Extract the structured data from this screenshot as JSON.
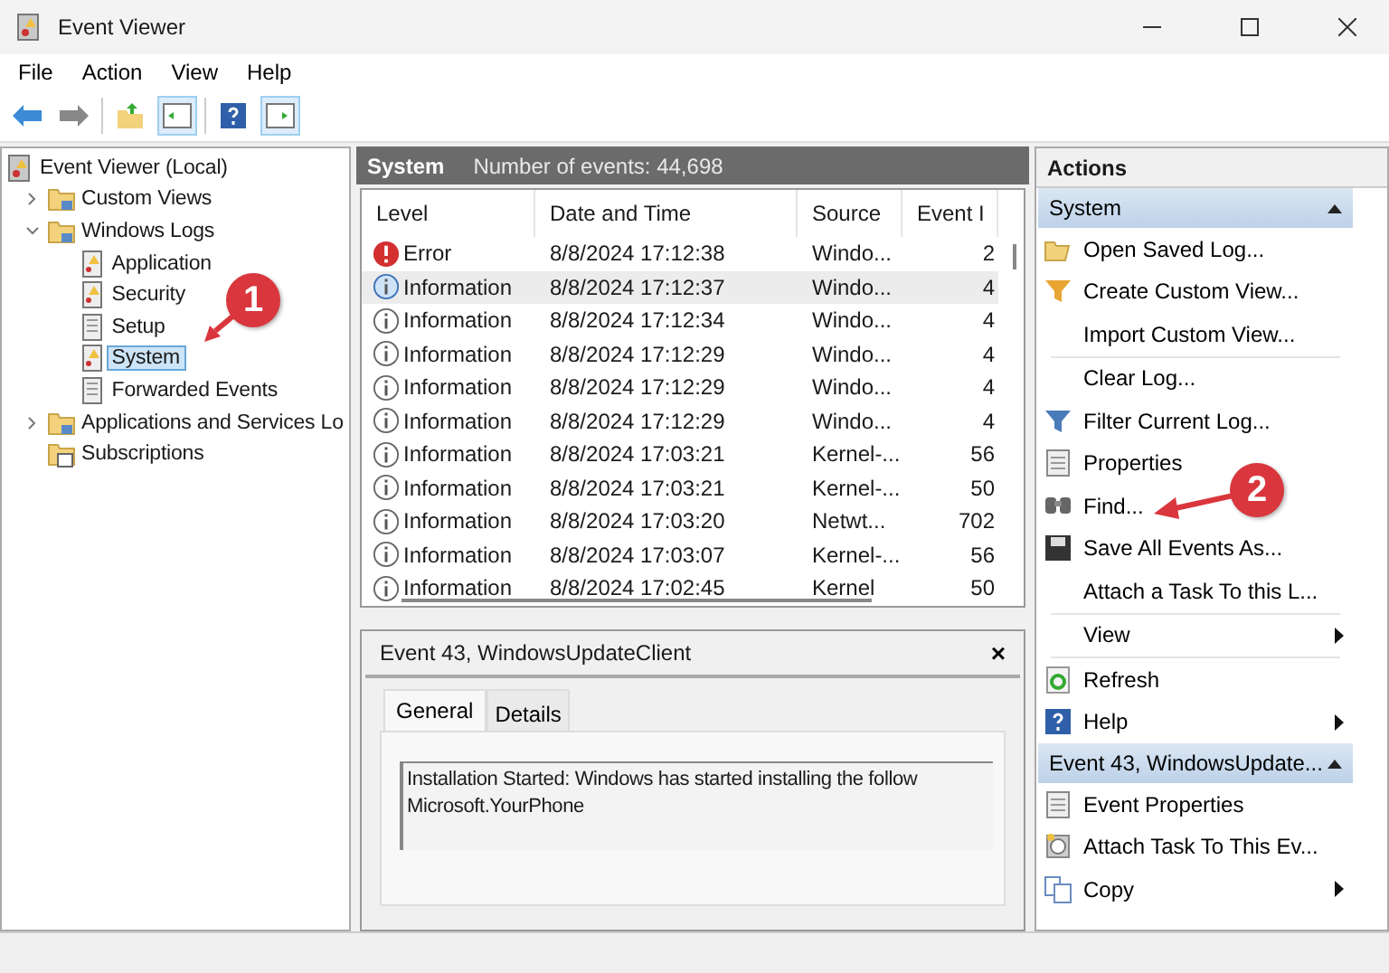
{
  "window": {
    "title": "Event Viewer"
  },
  "menu": [
    "File",
    "Action",
    "View",
    "Help"
  ],
  "tree": [
    {
      "label": "Event Viewer (Local)",
      "kind": "viewer",
      "selected": false,
      "children": [
        {
          "label": "Custom Views",
          "kind": "folder",
          "selected": false,
          "expanded": false
        },
        {
          "label": "Windows Logs",
          "kind": "folder",
          "selected": false,
          "expanded": true,
          "children": [
            {
              "label": "Application",
              "kind": "log",
              "selected": false
            },
            {
              "label": "Security",
              "kind": "log",
              "selected": false
            },
            {
              "label": "Setup",
              "kind": "plainlog",
              "selected": false
            },
            {
              "label": "System",
              "kind": "log",
              "selected": true
            },
            {
              "label": "Forwarded Events",
              "kind": "plainlog",
              "selected": false
            }
          ]
        },
        {
          "label": "Applications and Services Lo",
          "kind": "folder",
          "selected": false,
          "expanded": false
        },
        {
          "label": "Subscriptions",
          "kind": "subs",
          "selected": false
        }
      ]
    }
  ],
  "log_header": {
    "title": "System",
    "count": "Number of events: 44,698"
  },
  "table": {
    "columns": [
      "Level",
      "Date and Time",
      "Source",
      "Event I"
    ],
    "rows": [
      {
        "kind": "error",
        "level": "Error",
        "date": "8/8/2024 17:12:38",
        "source": "Windo...",
        "event": "2",
        "selected": false
      },
      {
        "kind": "info",
        "level": "Information",
        "date": "8/8/2024 17:12:37",
        "source": "Windo...",
        "event": "4",
        "selected": true
      },
      {
        "kind": "info",
        "level": "Information",
        "date": "8/8/2024 17:12:34",
        "source": "Windo...",
        "event": "4",
        "selected": false
      },
      {
        "kind": "info",
        "level": "Information",
        "date": "8/8/2024 17:12:29",
        "source": "Windo...",
        "event": "4",
        "selected": false
      },
      {
        "kind": "info",
        "level": "Information",
        "date": "8/8/2024 17:12:29",
        "source": "Windo...",
        "event": "4",
        "selected": false
      },
      {
        "kind": "info",
        "level": "Information",
        "date": "8/8/2024 17:12:29",
        "source": "Windo...",
        "event": "4",
        "selected": false
      },
      {
        "kind": "info",
        "level": "Information",
        "date": "8/8/2024 17:03:21",
        "source": "Kernel-...",
        "event": "56",
        "selected": false
      },
      {
        "kind": "info",
        "level": "Information",
        "date": "8/8/2024 17:03:21",
        "source": "Kernel-...",
        "event": "50",
        "selected": false
      },
      {
        "kind": "info",
        "level": "Information",
        "date": "8/8/2024 17:03:20",
        "source": "Netwt...",
        "event": "702",
        "selected": false
      },
      {
        "kind": "info",
        "level": "Information",
        "date": "8/8/2024 17:03:07",
        "source": "Kernel-...",
        "event": "56",
        "selected": false
      },
      {
        "kind": "info",
        "level": "Information",
        "date": "8/8/2024 17:02:45",
        "source": "Kernel",
        "event": "50",
        "selected": false
      }
    ]
  },
  "detail": {
    "title": "Event 43, WindowsUpdateClient",
    "close": "×",
    "tabs": [
      {
        "label": "General",
        "selected": true
      },
      {
        "label": "Details",
        "selected": false
      }
    ],
    "text": [
      "Installation Started: Windows has started installing the follow",
      "Microsoft.YourPhone"
    ]
  },
  "actions": {
    "title": "Actions",
    "sections": [
      {
        "title": "System",
        "expanded": true,
        "groups": [
          [
            {
              "label": "Open Saved Log...",
              "kind": "open"
            },
            {
              "label": "Create Custom View...",
              "kind": "filter"
            },
            {
              "label": "Import Custom View...",
              "kind": "none"
            }
          ],
          [
            {
              "label": "Clear Log...",
              "kind": "none"
            },
            {
              "label": "Filter Current Log...",
              "kind": "filter2"
            },
            {
              "label": "Properties",
              "kind": "props"
            },
            {
              "label": "Find...",
              "kind": "find"
            },
            {
              "label": "Save All Events As...",
              "kind": "save"
            },
            {
              "label": "Attach a Task To this L...",
              "kind": "none"
            }
          ],
          [
            {
              "label": "View",
              "kind": "none",
              "submenu": true
            }
          ],
          [
            {
              "label": "Refresh",
              "kind": "refresh"
            },
            {
              "label": "Help",
              "kind": "help",
              "submenu": true
            }
          ]
        ]
      },
      {
        "title": "Event 43, WindowsUpdate...",
        "expanded": true,
        "groups": [
          [
            {
              "label": "Event Properties",
              "kind": "props"
            },
            {
              "label": "Attach Task To This Ev...",
              "kind": "task"
            },
            {
              "label": "Copy",
              "kind": "copy",
              "submenu": true
            }
          ]
        ]
      }
    ]
  },
  "callouts": [
    {
      "label": "1"
    },
    {
      "label": "2"
    }
  ]
}
